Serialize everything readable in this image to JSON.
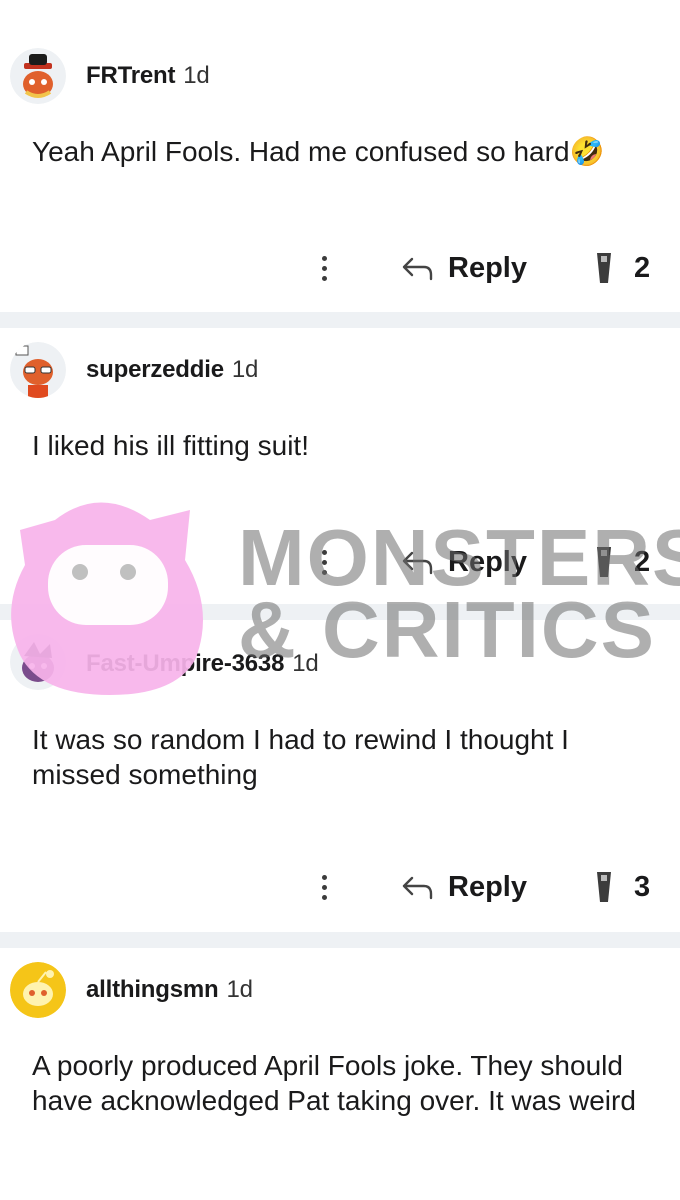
{
  "comments": [
    {
      "user": "FRTrent",
      "age": "1d",
      "text": "Yeah April Fools. Had me confused so hard🤣",
      "reply_label": "Reply",
      "award_count": "2",
      "avatar_icon": "snoo-avatar-hat-icon"
    },
    {
      "user": "superzeddie",
      "age": "1d",
      "text": "I liked his ill fitting suit!",
      "reply_label": "Reply",
      "award_count": "2",
      "avatar_icon": "snoo-avatar-glasses-icon"
    },
    {
      "user": "Fast-Umpire-3638",
      "age": "1d",
      "text": "It was so random I had to rewind I thought I missed something",
      "reply_label": "Reply",
      "award_count": "3",
      "avatar_icon": "snoo-avatar-purple-icon"
    },
    {
      "user": "allthingsmn",
      "age": "1d",
      "text": "A poorly produced April Fools joke. They should have acknowledged Pat taking over. It was weird",
      "avatar_icon": "snoo-avatar-yellow-icon"
    }
  ],
  "watermark": {
    "line1": "MONSTERS",
    "line2": "& CRITICS"
  },
  "colors": {
    "divider": "#eef1f4",
    "watermark_pink": "#f7b3ea",
    "watermark_gray": "#6e6e6e"
  }
}
